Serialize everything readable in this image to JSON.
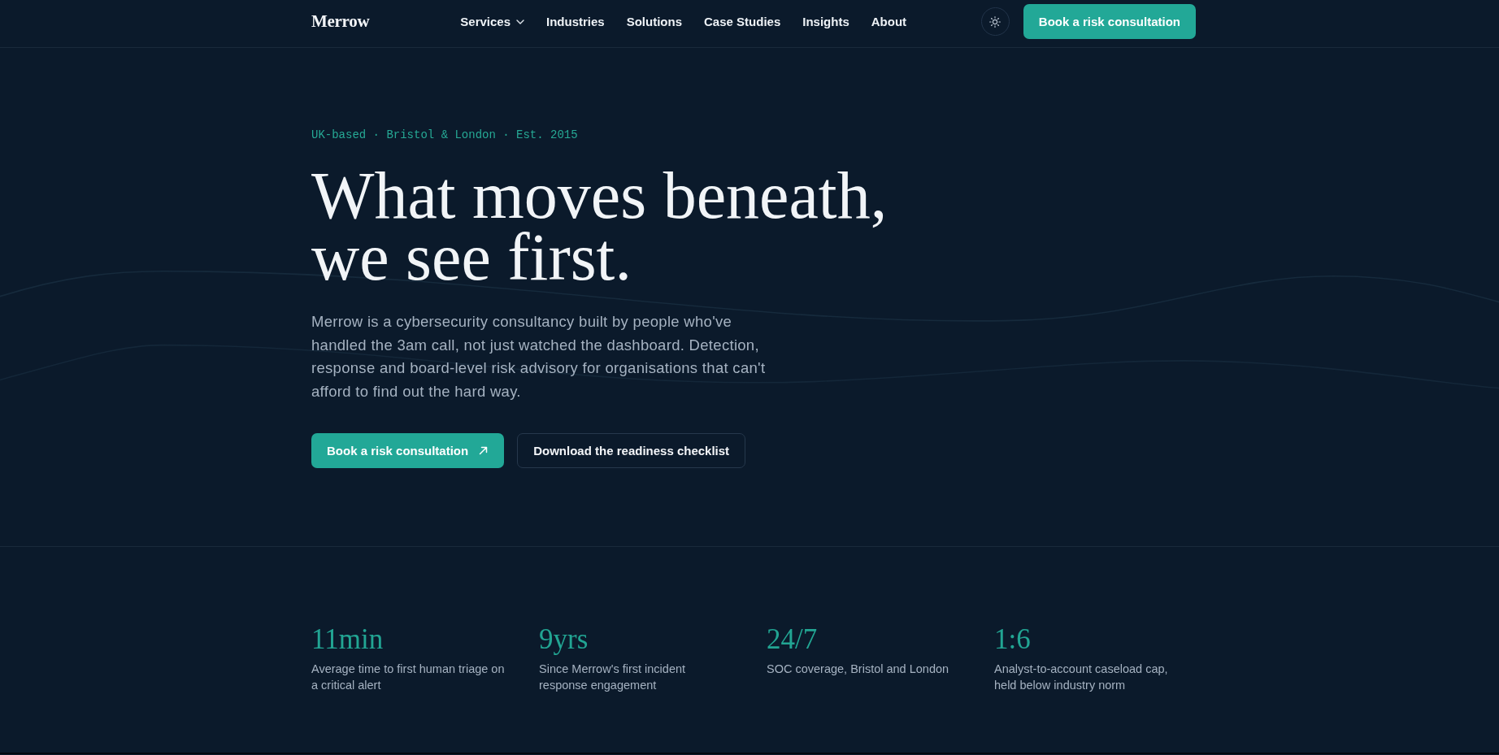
{
  "nav": {
    "logo": "Merrow",
    "links": [
      {
        "label": "Services",
        "has_menu": true
      },
      {
        "label": "Industries",
        "has_menu": false
      },
      {
        "label": "Solutions",
        "has_menu": false
      },
      {
        "label": "Case Studies",
        "has_menu": false
      },
      {
        "label": "Insights",
        "has_menu": false
      },
      {
        "label": "About",
        "has_menu": false
      }
    ],
    "cta": "Book a risk consultation"
  },
  "hero": {
    "eyebrow": "UK-based · Bristol & London · Est. 2015",
    "headline": "What moves beneath, we see first.",
    "body": "Merrow is a cybersecurity consultancy built by people who've handled the 3am call, not just watched the dashboard. Detection, response and board-level risk advisory for organisations that can't afford to find out the hard way.",
    "buttons": [
      {
        "label": "Book a risk consultation",
        "kind": "primary"
      },
      {
        "label": "Download the readiness checklist",
        "kind": "secondary"
      }
    ]
  },
  "stats": [
    {
      "value": "11min",
      "label": "Average time to first human triage on a critical alert"
    },
    {
      "value": "9yrs",
      "label": "Since Merrow's first incident response engagement"
    },
    {
      "value": "24/7",
      "label": "SOC coverage, Bristol and London"
    },
    {
      "value": "1:6",
      "label": "Analyst-to-account caseload cap, held below industry norm"
    }
  ]
}
